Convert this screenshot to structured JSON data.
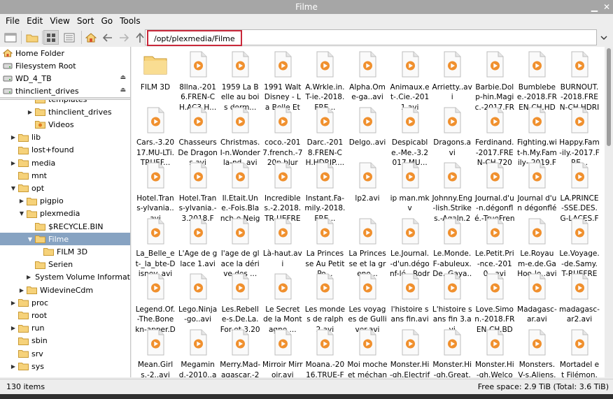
{
  "window": {
    "title": "Filme"
  },
  "menu": [
    "File",
    "Edit",
    "View",
    "Sort",
    "Go",
    "Tools"
  ],
  "path": {
    "value": "/opt/plexmedia/Filme"
  },
  "places": [
    {
      "label": "Home Folder",
      "icon": "home-icon",
      "eject": false
    },
    {
      "label": "Filesystem Root",
      "icon": "drive-icon",
      "eject": false
    },
    {
      "label": "WD_4_TB",
      "icon": "drive-icon",
      "eject": true
    },
    {
      "label": "thinclient_drives",
      "icon": "drive-icon",
      "eject": true
    }
  ],
  "tree": [
    {
      "label": "templates",
      "depth": 3,
      "arrow": "",
      "partial": true
    },
    {
      "label": "thinclient_drives",
      "depth": 3,
      "arrow": "▶"
    },
    {
      "label": "Videos",
      "depth": 3,
      "arrow": "",
      "special": true
    },
    {
      "label": "lib",
      "depth": 1,
      "arrow": "▶"
    },
    {
      "label": "lost+found",
      "depth": 1,
      "arrow": ""
    },
    {
      "label": "media",
      "depth": 1,
      "arrow": "▶"
    },
    {
      "label": "mnt",
      "depth": 1,
      "arrow": ""
    },
    {
      "label": "opt",
      "depth": 1,
      "arrow": "▼"
    },
    {
      "label": "pigpio",
      "depth": 2,
      "arrow": "▶"
    },
    {
      "label": "plexmedia",
      "depth": 2,
      "arrow": "▼"
    },
    {
      "label": "$RECYCLE.BIN",
      "depth": 3,
      "arrow": ""
    },
    {
      "label": "Filme",
      "depth": 3,
      "arrow": "▼",
      "selected": true
    },
    {
      "label": "FILM 3D",
      "depth": 4,
      "arrow": ""
    },
    {
      "label": "Serien",
      "depth": 3,
      "arrow": ""
    },
    {
      "label": "System Volume Informatic",
      "depth": 3,
      "arrow": "▶"
    },
    {
      "label": "WidevineCdm",
      "depth": 2,
      "arrow": "▶"
    },
    {
      "label": "proc",
      "depth": 1,
      "arrow": "▶"
    },
    {
      "label": "root",
      "depth": 1,
      "arrow": ""
    },
    {
      "label": "run",
      "depth": 1,
      "arrow": "▶"
    },
    {
      "label": "sbin",
      "depth": 1,
      "arrow": ""
    },
    {
      "label": "srv",
      "depth": 1,
      "arrow": ""
    },
    {
      "label": "sys",
      "depth": 1,
      "arrow": "▶"
    }
  ],
  "files": [
    {
      "name": "FILM 3D",
      "type": "folder"
    },
    {
      "name": "8llna.-2016.FREN-CH.AC3.H...",
      "type": "video"
    },
    {
      "name": "1959 La Belle au bois dorm...",
      "type": "video"
    },
    {
      "name": "1991 Walt Disney - La Belle Et La ...",
      "type": "video"
    },
    {
      "name": "A.Wrkle.in.T-ie.-2018.FRE...",
      "type": "video"
    },
    {
      "name": "Alpha.Ome-ga..avi",
      "type": "video"
    },
    {
      "name": "Animaux.et-.Cie.-2011.avi",
      "type": "video"
    },
    {
      "name": "Arrietty..avi",
      "type": "video"
    },
    {
      "name": "Barbie.Dolp-hin.Magic.-2017.FRE...",
      "type": "video"
    },
    {
      "name": "Bumblebee.-2018.FREN-CH.HDRip....",
      "type": "video"
    },
    {
      "name": "BURNOUT.-2018.FREN-CH.HDRIP....",
      "type": "video"
    },
    {
      "name": "Cars.-3.2017.MU-LTi.TRUEF...",
      "type": "video"
    },
    {
      "name": "Chasseurs De Dragons.avi",
      "type": "video"
    },
    {
      "name": "Christmas.I-n.Wonderla-nd..avi",
      "type": "video"
    },
    {
      "name": "coco.-2017.french.-720p.blura...",
      "type": "video"
    },
    {
      "name": "Darc.-2018.FREN-CH.HDRIP....",
      "type": "video"
    },
    {
      "name": "Delgo..avi",
      "type": "video"
    },
    {
      "name": "Despicable.-Me.-3.2017.MU...",
      "type": "video"
    },
    {
      "name": "Dragons.avi",
      "type": "video"
    },
    {
      "name": "Ferdinand.-2017.FREN-CH.720p.B...",
      "type": "video"
    },
    {
      "name": "Fighting.wit-h.My.Family-.2019.FR...",
      "type": "video"
    },
    {
      "name": "Happy.Fam-ily.-2017.FRE...",
      "type": "video"
    },
    {
      "name": "Hotel.Trans-ylvania..avi",
      "type": "video"
    },
    {
      "name": "Hotel.Trans-ylvania.-3.2018.FR...",
      "type": "video"
    },
    {
      "name": "Il.Etait.Une.-Fois.Blanch-e.Neige..avi",
      "type": "video"
    },
    {
      "name": "Incredibles.-2.2018.TR-UEFRENC...",
      "type": "video"
    },
    {
      "name": "Instant.Fa-mily.-2018.FRE...",
      "type": "video"
    },
    {
      "name": "lp2.avi",
      "type": "video"
    },
    {
      "name": "ip man.mkv",
      "type": "video"
    },
    {
      "name": "Johnny.Eng-lish.Strikes.-Agaln.201...",
      "type": "video"
    },
    {
      "name": "Journal.d'u-n.dégonflé.-TrueFrenc...",
      "type": "video"
    },
    {
      "name": "Journal d'un dégonflé ...",
      "type": "video"
    },
    {
      "name": "LA.PRINCE-SSE.DES.G-LACES.FR...",
      "type": "video"
    },
    {
      "name": "La_Belle_et-_la_bte-Disney..avi",
      "type": "video"
    },
    {
      "name": "L'Age de glace 1.avi",
      "type": "video"
    },
    {
      "name": "l'age de glace la dérive des ...",
      "type": "video"
    },
    {
      "name": "Là-haut.avi",
      "type": "video"
    },
    {
      "name": "La Princesse Au Petit Po...",
      "type": "video"
    },
    {
      "name": "La Princesse et la grenо...",
      "type": "video"
    },
    {
      "name": "Le.Journal.-d'un.dégonf-lé...Rodric...",
      "type": "video"
    },
    {
      "name": "Le.Monde.F-abuleux.De.-Gaya..avi",
      "type": "video"
    },
    {
      "name": "Le.Petit.Pri-nce.-2010...avi",
      "type": "video"
    },
    {
      "name": "Le.Royaum-e.de.GaHoo-le..avi",
      "type": "video"
    },
    {
      "name": "Le.Voyage.-de.Samy.T-RUEFREN...",
      "type": "video"
    },
    {
      "name": "Legend.Of.-The.Bonekn-apper.Drag...",
      "type": "video"
    },
    {
      "name": "Lego.Ninja-go..avi",
      "type": "video"
    },
    {
      "name": "Les.Rebelle-s.De.La.For-et.3.2010....",
      "type": "video"
    },
    {
      "name": "Le Secret de la Montagne ...",
      "type": "video"
    },
    {
      "name": "Les mondes de ralph 2.avi",
      "type": "video"
    },
    {
      "name": "Les voyages de Gulliver.avi",
      "type": "video"
    },
    {
      "name": "l'histoire sans fin.avi",
      "type": "video"
    },
    {
      "name": "L'histoire sans fin 3.avi",
      "type": "video"
    },
    {
      "name": "Love.Simon.-2018.FREN-CH.BDRip....",
      "type": "video"
    },
    {
      "name": "Madagasc-ar.avi",
      "type": "video"
    },
    {
      "name": "madagasc-ar2.avi",
      "type": "video"
    },
    {
      "name": "Mean.Girls.-2..avi",
      "type": "video"
    },
    {
      "name": "Megamind.-2010..avi",
      "type": "video"
    },
    {
      "name": "Merry.Mad-agascar.-2009.avi",
      "type": "video"
    },
    {
      "name": "Mirroir Mirroir.avi",
      "type": "video"
    },
    {
      "name": "Moana.-2016.TRUE-FRENCH.7...",
      "type": "video"
    },
    {
      "name": "Moi moche et méchant.avi",
      "type": "video"
    },
    {
      "name": "Monster.Hi-gh.Electrifie-d.2017.FR...",
      "type": "video"
    },
    {
      "name": "Monster.Hi-gh.Great.Sc-arrier.Reef....",
      "type": "video"
    },
    {
      "name": "Monster.Hi-gh.Welcom-e.To.Mons...",
      "type": "video"
    },
    {
      "name": "Monsters.V-s.Aliens.avi",
      "type": "video"
    },
    {
      "name": "Mortadel et Filémon.avi",
      "type": "video"
    }
  ],
  "status": {
    "items": "130 items",
    "free": "Free space: 2.9 TiB (Total: 3.6 TiB)"
  },
  "colors": {
    "selection": "#87a3c2",
    "folder": "#f6d27a",
    "video_badge": "#f0902e",
    "path_highlight": "#c9283a"
  }
}
